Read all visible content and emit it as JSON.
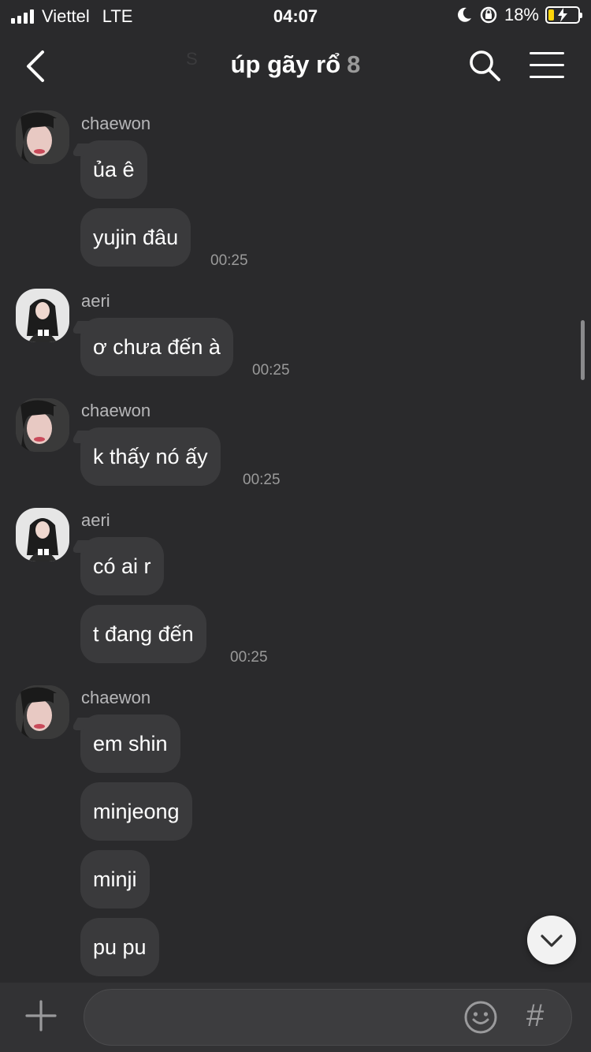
{
  "status_bar": {
    "carrier": "Viettel",
    "network": "LTE",
    "time": "04:07",
    "battery": "18%"
  },
  "header": {
    "title": "úp gãy rổ",
    "member_count": "8",
    "date_ghost": "S"
  },
  "messages": [
    {
      "sender": "chaewon",
      "bubbles": [
        "ủa ê",
        "yujin đâu"
      ],
      "time": "00:25"
    },
    {
      "sender": "aeri",
      "bubbles": [
        "ơ chưa đến à"
      ],
      "time": "00:25"
    },
    {
      "sender": "chaewon",
      "bubbles": [
        "k thấy nó ấy"
      ],
      "time": "00:25"
    },
    {
      "sender": "aeri",
      "bubbles": [
        "có ai r",
        "t đang đến"
      ],
      "time": "00:25"
    },
    {
      "sender": "chaewon",
      "bubbles": [
        "em shin",
        "minjeong",
        "minji",
        "pu pu"
      ]
    }
  ],
  "icons": {
    "back": "chevron-left-icon",
    "search": "search-icon",
    "menu": "menu-icon",
    "scroll_down": "chevron-down-icon",
    "attach": "plus-icon",
    "emoji": "emoji-icon",
    "hashtag": "hashtag-icon"
  },
  "composer": {
    "hashtag_glyph": "#"
  },
  "colors": {
    "background": "#2a2a2c",
    "bubble": "#3a3a3c",
    "battery_fill": "#ffd60a"
  }
}
